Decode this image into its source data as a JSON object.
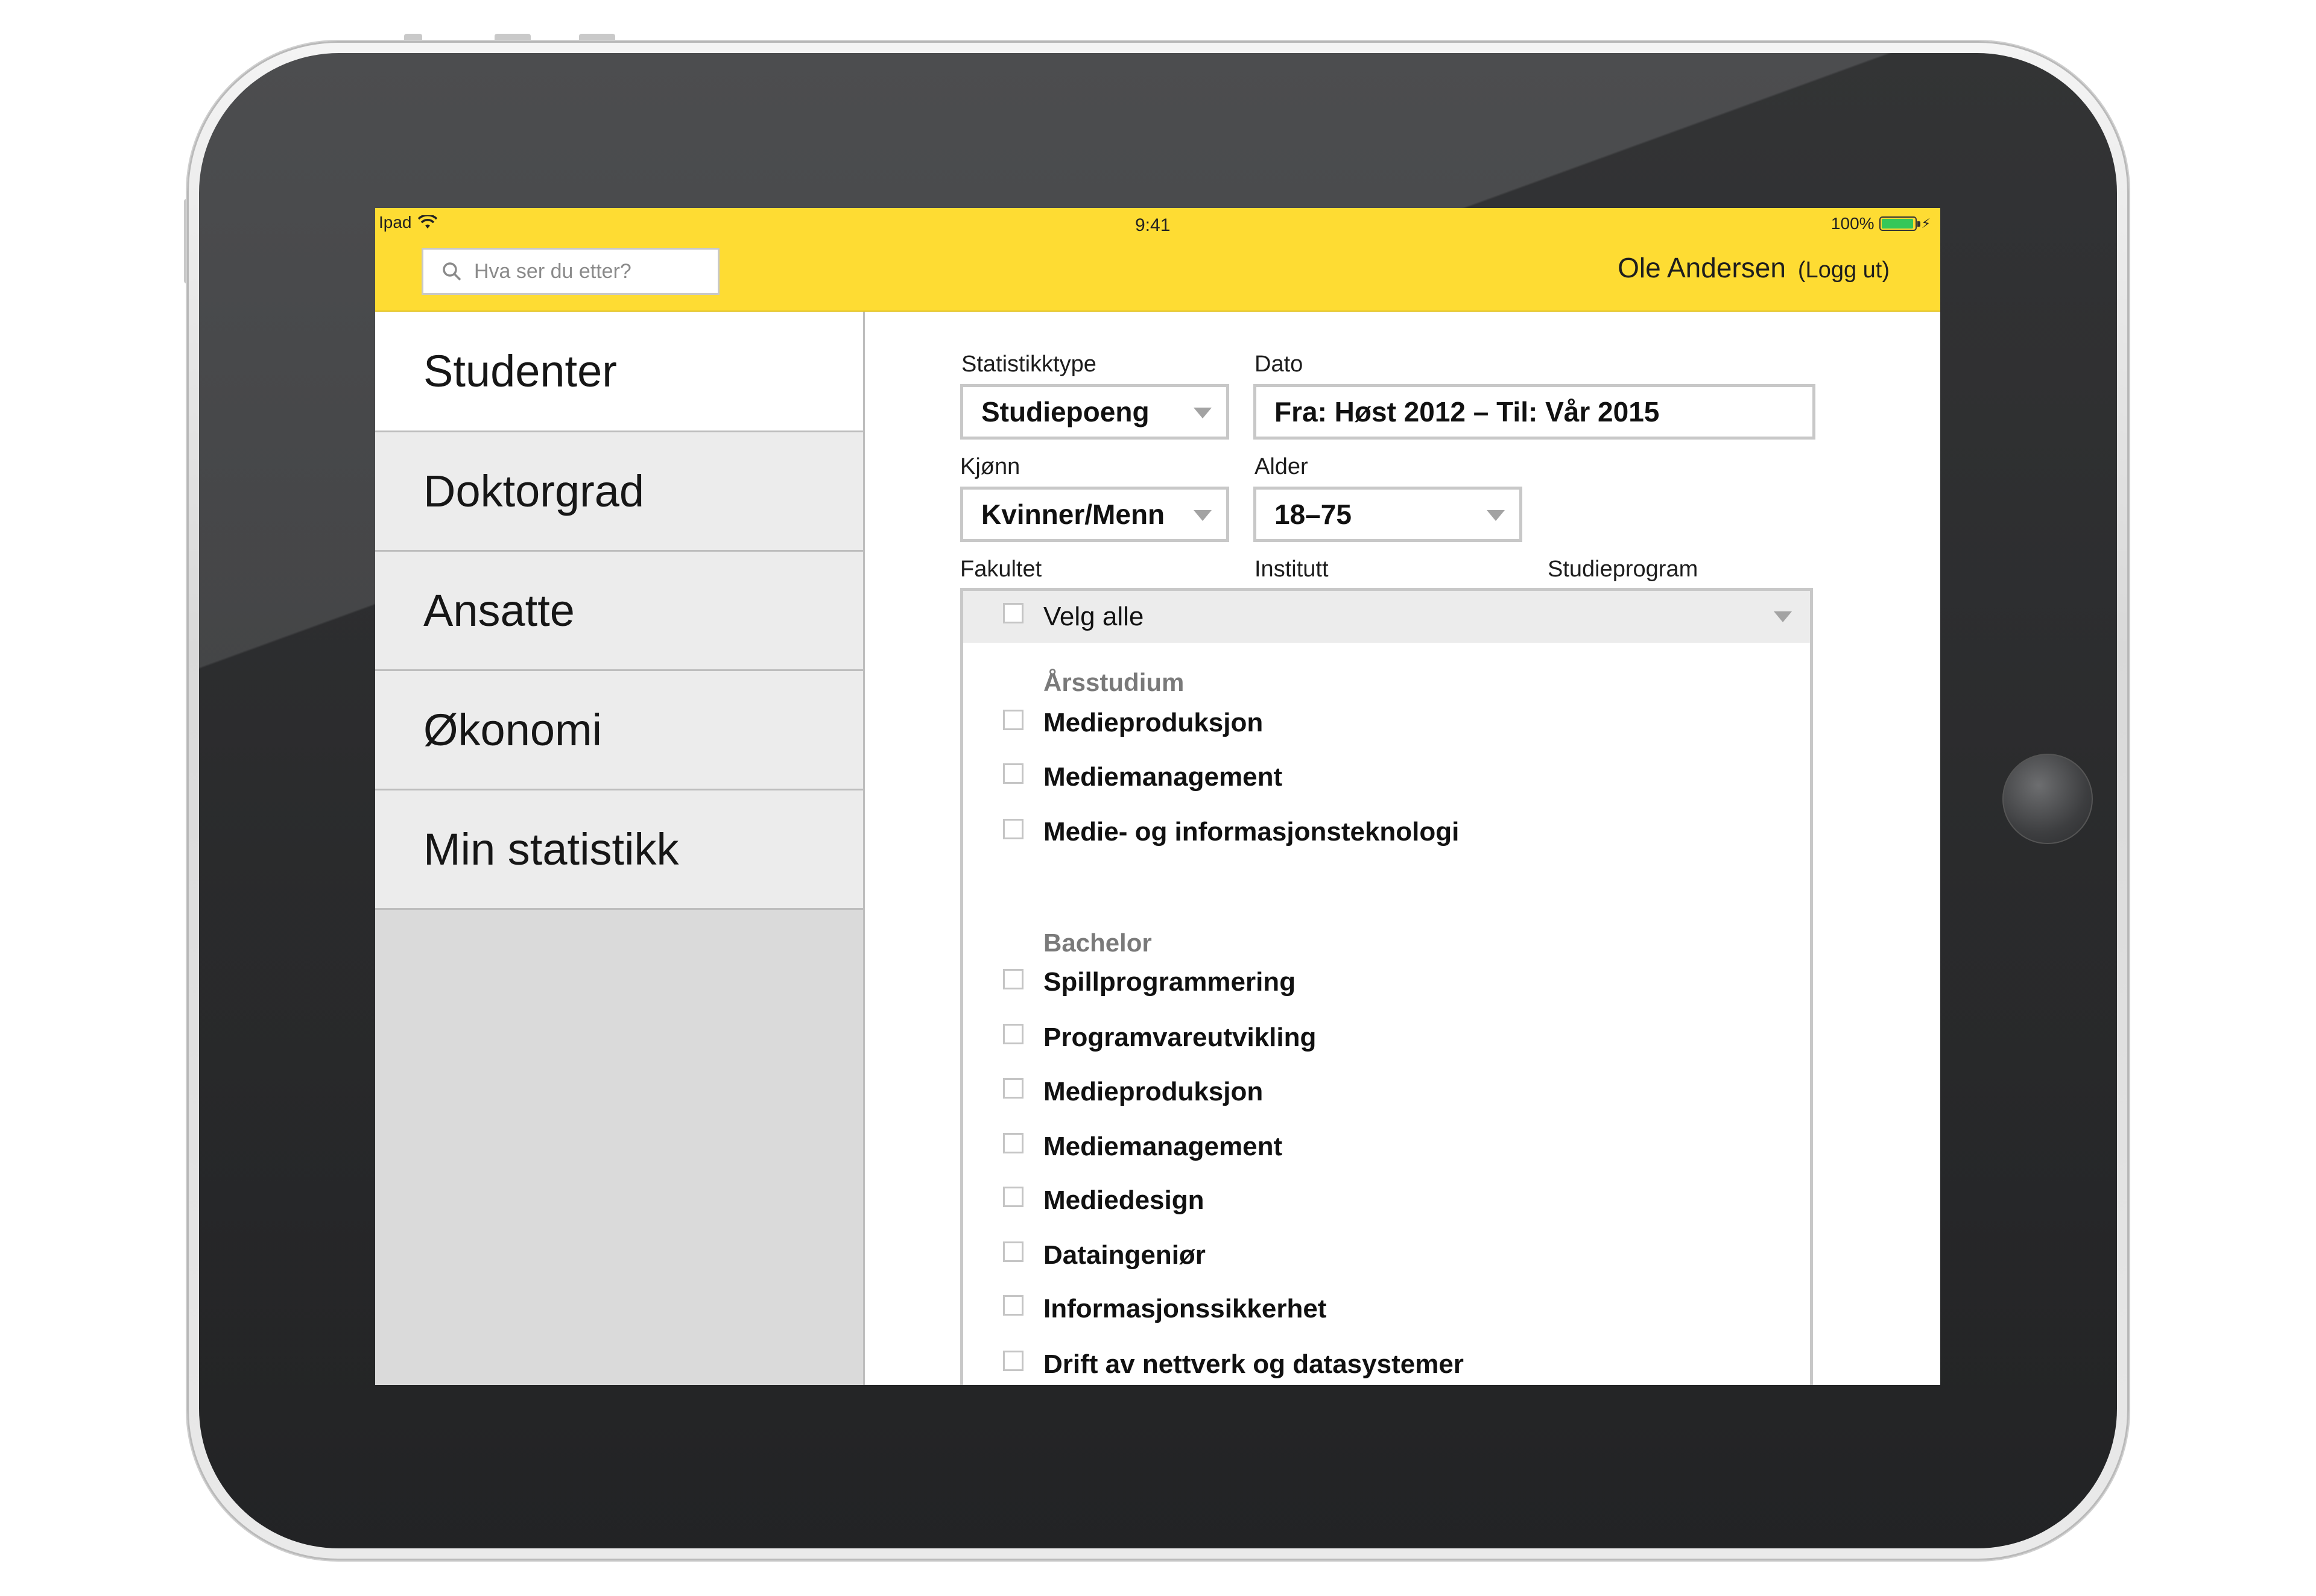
{
  "status_bar": {
    "carrier": "Ipad",
    "time": "9:41",
    "battery": "100%"
  },
  "header": {
    "search_placeholder": "Hva ser du etter?",
    "user_name": "Ole Andersen",
    "logout_label": "(Logg ut)",
    "accent_color": "#fedc33"
  },
  "sidebar": {
    "items": [
      {
        "label": "Studenter",
        "active": true
      },
      {
        "label": "Doktorgrad",
        "active": false
      },
      {
        "label": "Ansatte",
        "active": false
      },
      {
        "label": "Økonomi",
        "active": false
      },
      {
        "label": "Min statistikk",
        "active": false
      }
    ]
  },
  "filters": {
    "statistikktype": {
      "label": "Statistikktype",
      "value": "Studiepoeng"
    },
    "dato": {
      "label": "Dato",
      "value": "Fra: Høst 2012 – Til: Vår 2015"
    },
    "kjonn": {
      "label": "Kjønn",
      "value": "Kvinner/Menn"
    },
    "alder": {
      "label": "Alder",
      "value": "18–75"
    },
    "fakultet_label": "Fakultet",
    "institutt_label": "Institutt",
    "studieprogram_label": "Studieprogram"
  },
  "program_list": {
    "select_all": "Velg alle",
    "groups": [
      {
        "heading": "Årsstudium",
        "items": [
          "Medieproduksjon",
          "Mediemanagement",
          "Medie- og informasjonsteknologi"
        ]
      },
      {
        "heading": "Bachelor",
        "items": [
          "Spillprogrammering",
          "Programvareutvikling",
          "Medieproduksjon",
          "Mediemanagement",
          "Mediedesign",
          "Dataingeniør",
          "Informasjonssikkerhet",
          "Drift av nettverk og datasystemer"
        ]
      }
    ]
  }
}
